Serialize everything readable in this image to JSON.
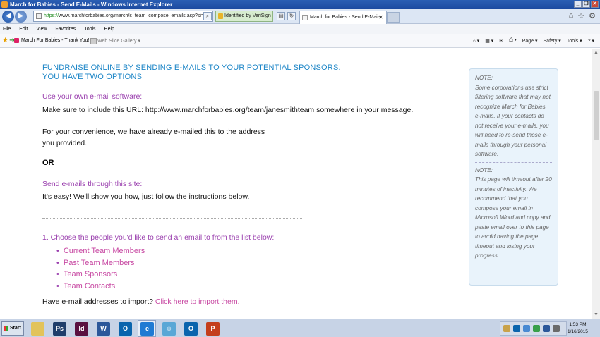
{
  "window": {
    "title": "March for Babies - Send E-Mails - Windows Internet Explorer"
  },
  "nav": {
    "url_prefix": "https://",
    "url_rest": "www.marchforbabies.org/march/s_team_compose_emails.asp?si=",
    "security_label": "Identified by VeriSign",
    "tab_title": "March for Babies - Send E-Mails",
    "tab_close": "✕"
  },
  "menu": [
    "File",
    "Edit",
    "View",
    "Favorites",
    "Tools",
    "Help"
  ],
  "favorites": {
    "items": [
      "March For Babies - Thank You!",
      "Web Slice Gallery ▾"
    ]
  },
  "command_bar": [
    "Page ▾",
    "Safety ▾",
    "Tools ▾",
    "? ▾"
  ],
  "page": {
    "heading_line1": "FUNDRAISE ONLINE BY SENDING E-MAILS TO YOUR POTENTIAL SPONSORS.",
    "heading_line2": "YOU HAVE TWO OPTIONS",
    "option1_title": "Use your own e-mail software:",
    "option1_text": "Make sure to include this URL: http://www.marchforbabies.org/team/janesmithteam somewhere in your message.",
    "convenience_line1": "For your convenience, we have already e-mailed this to the address",
    "convenience_line2": "you provided.",
    "or": "OR",
    "option2_title": "Send e-mails through this site:",
    "option2_text": "It's easy! We'll show you how, just follow the instructions below.",
    "step1": "1. Choose the people you'd like to send an email to from the list below:",
    "list": [
      "Current Team Members",
      "Past Team Members",
      "Team Sponsors",
      "Team Contacts"
    ],
    "import_prefix": "Have e-mail addresses to import?",
    "import_link": "Click here to import them."
  },
  "note": {
    "note1_title": "NOTE:",
    "note1_text": "Some corporations use strict filtering software that may not recognize March for Babies e-mails. If your contacts do not receive your e-mails, you will need to re-send those e-mails through your personal software.",
    "note2_title": "NOTE:",
    "note2_text": "This page will timeout after 20 minutes of inactivity. We recommend that you compose your email in Microsoft Word and copy and paste email over to this page to avoid having the page timeout and losing your progress."
  },
  "taskbar": {
    "start_label": "Start",
    "apps": [
      {
        "name": "explorer",
        "glyph": "",
        "color": "#e2c35a"
      },
      {
        "name": "photoshop",
        "glyph": "Ps",
        "color": "#1f3d6b"
      },
      {
        "name": "indesign",
        "glyph": "Id",
        "color": "#5a1040"
      },
      {
        "name": "word",
        "glyph": "W",
        "color": "#2b579a"
      },
      {
        "name": "outlook",
        "glyph": "O",
        "color": "#0a64ad"
      },
      {
        "name": "internet-explorer",
        "glyph": "e",
        "color": "#1f7ad3"
      },
      {
        "name": "messenger",
        "glyph": "☺",
        "color": "#59a7d6"
      },
      {
        "name": "outlook-2",
        "glyph": "O",
        "color": "#0a64ad"
      },
      {
        "name": "powerpoint",
        "glyph": "P",
        "color": "#c43e1c"
      }
    ],
    "time": "1:53 PM",
    "date": "1/16/2015"
  },
  "colors": {
    "heading_blue": "#1d86c7",
    "purple": "#9a3fae",
    "pink_link": "#c84aa3",
    "note_bg": "#e9f3fb"
  }
}
